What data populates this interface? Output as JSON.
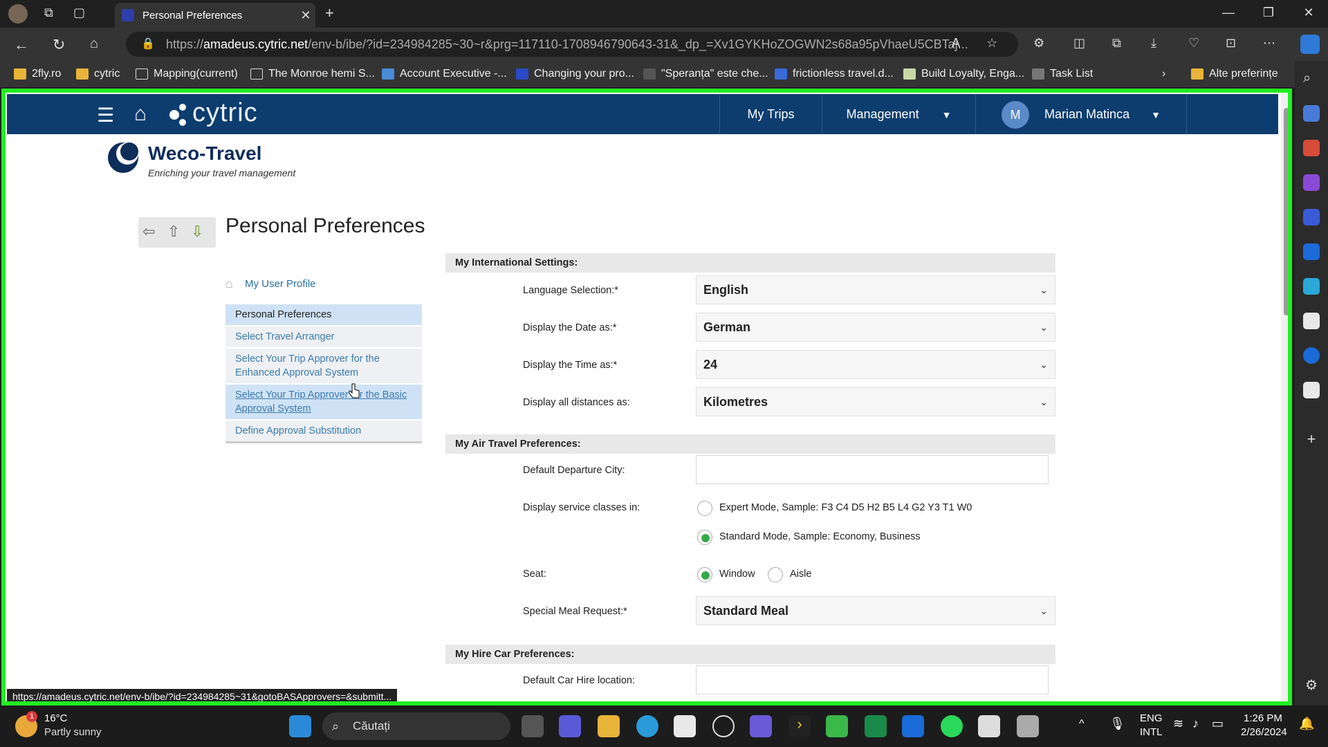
{
  "browser": {
    "tab_title": "Personal Preferences",
    "url_host": "amadeus.cytric.net",
    "url_prefix": "https://",
    "url_rest": "/env-b/ibe/?id=234984285~30~r&prg=117110-1708946790643-31&_dp_=Xv1GYKHoZOGWN2s68a95pVhaeU5CBTaj...",
    "status_url": "https://amadeus.cytric.net/env-b/ibe/?id=234984285~31&gotoBASApprovers=&submitt...",
    "bookmarks": [
      "2fly.ro",
      "cytric",
      "Mapping(current)",
      "The Monroe hemi S...",
      "Account Executive -...",
      "Changing your pro...",
      "\"Speranța\" este che...",
      "frictionless travel.d...",
      "Build Loyalty, Enga...",
      "Task List"
    ],
    "bookmarks_other": "Alte preferințe"
  },
  "app": {
    "logo": "cytric",
    "nav": {
      "my_trips": "My Trips",
      "management": "Management",
      "user_initial": "M",
      "user_name": "Marian Matinca"
    },
    "company": {
      "name": "Weco-Travel",
      "tagline": "Enriching your travel management"
    },
    "page_title": "Personal Preferences",
    "profile_link": "My User Profile",
    "menu": [
      "Personal Preferences",
      "Select Travel Arranger",
      "Select Your Trip Approver for the Enhanced Approval System",
      "Select Your Trip Approver for the Basic Approval System",
      "Define Approval Substitution"
    ]
  },
  "form": {
    "intl": {
      "heading": "My International Settings:",
      "language_label": "Language Selection:*",
      "language_value": "English",
      "date_label": "Display the Date as:*",
      "date_value": "German",
      "time_label": "Display the Time as:*",
      "time_value": "24",
      "distance_label": "Display all distances as:",
      "distance_value": "Kilometres"
    },
    "air": {
      "heading": "My Air Travel Preferences:",
      "departure_label": "Default Departure City:",
      "departure_value": "",
      "classes_label": "Display service classes in:",
      "expert_mode": "Expert Mode, Sample: F3 C4 D5 H2 B5 L4 G2 Y3 T1 W0",
      "standard_mode": "Standard Mode, Sample: Economy, Business",
      "seat_label": "Seat:",
      "seat_window": "Window",
      "seat_aisle": "Aisle",
      "meal_label": "Special Meal Request:*",
      "meal_value": "Standard Meal"
    },
    "car": {
      "heading": "My Hire Car Preferences:",
      "location_label": "Default Car Hire location:",
      "location_value": ""
    }
  },
  "taskbar": {
    "temperature": "16°C",
    "weather": "Partly sunny",
    "weather_badge": "1",
    "search_placeholder": "Căutați",
    "lang1": "ENG",
    "lang2": "INTL",
    "time": "1:26 PM",
    "date": "2/26/2024"
  },
  "colors": {
    "header": "#0d3d6e",
    "frame_highlight": "#22ee22",
    "radio_checked": "#3aa84a",
    "link": "#3a7ab0"
  }
}
